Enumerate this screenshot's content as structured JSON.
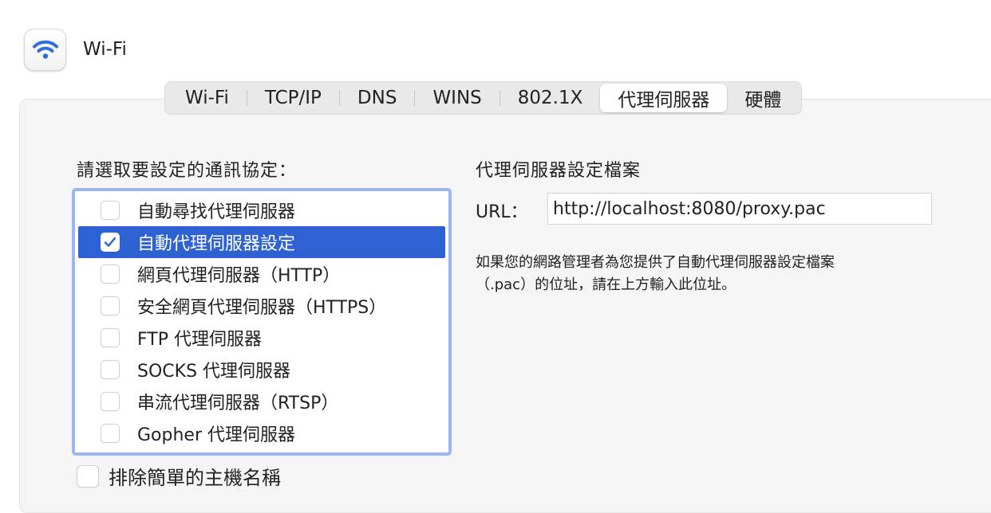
{
  "header": {
    "title": "Wi-Fi",
    "icon": "wifi-icon",
    "icon_color": "#2d6fe3"
  },
  "tabs": [
    {
      "label": "Wi-Fi",
      "active": false
    },
    {
      "label": "TCP/IP",
      "active": false
    },
    {
      "label": "DNS",
      "active": false
    },
    {
      "label": "WINS",
      "active": false
    },
    {
      "label": "802.1X",
      "active": false
    },
    {
      "label": "代理伺服器",
      "active": true
    },
    {
      "label": "硬體",
      "active": false
    }
  ],
  "protocols": {
    "label": "請選取要設定的通訊協定：",
    "items": [
      {
        "label": "自動尋找代理伺服器",
        "checked": false,
        "selected": false
      },
      {
        "label": "自動代理伺服器設定",
        "checked": true,
        "selected": true
      },
      {
        "label": "網頁代理伺服器（HTTP）",
        "checked": false,
        "selected": false
      },
      {
        "label": "安全網頁代理伺服器（HTTPS）",
        "checked": false,
        "selected": false
      },
      {
        "label": "FTP 代理伺服器",
        "checked": false,
        "selected": false
      },
      {
        "label": "SOCKS 代理伺服器",
        "checked": false,
        "selected": false
      },
      {
        "label": "串流代理伺服器（RTSP）",
        "checked": false,
        "selected": false
      },
      {
        "label": "Gopher 代理伺服器",
        "checked": false,
        "selected": false
      }
    ]
  },
  "exclude_simple_hostnames": {
    "label": "排除簡單的主機名稱",
    "checked": false
  },
  "config": {
    "heading": "代理伺服器設定檔案",
    "url_label": "URL：",
    "url_value": "http://localhost:8080/proxy.pac",
    "help_line_1": "如果您的網路管理者為您提供了自動代理伺服器設定檔案",
    "help_line_2": "（.pac）的位址，請在上方輸入此位址。"
  },
  "colors": {
    "selection": "#2e62d3",
    "focus_ring": "#9db6ef",
    "panel_bg": "#f5f5f5"
  }
}
